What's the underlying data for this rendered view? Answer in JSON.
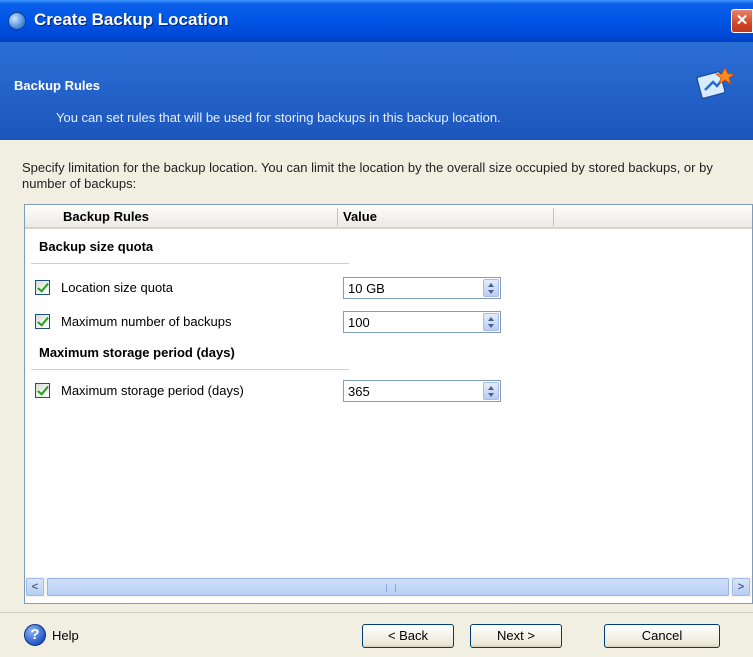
{
  "window": {
    "title": "Create Backup Location"
  },
  "banner": {
    "title": "Backup Rules",
    "subtitle": "You can set rules that will be used for storing backups in this backup location."
  },
  "intro": "Specify limitation for the backup location. You can limit the location by the overall size occupied by stored backups, or by number of backups:",
  "grid": {
    "col_rules": "Backup Rules",
    "col_value": "Value",
    "groups": [
      {
        "label": "Backup size quota",
        "rows": [
          {
            "label": "Location size quota",
            "value": "10 GB",
            "checked": true
          },
          {
            "label": "Maximum number of backups",
            "value": "100",
            "checked": true
          }
        ]
      },
      {
        "label": "Maximum storage period (days)",
        "rows": [
          {
            "label": "Maximum storage period (days)",
            "value": "365",
            "checked": true
          }
        ]
      }
    ]
  },
  "footer": {
    "help": "Help",
    "back": "< Back",
    "next": "Next >",
    "cancel": "Cancel"
  },
  "icons": {
    "title": "app-icon",
    "close": "close-icon",
    "banner": "backup-rules-icon",
    "help": "help-icon",
    "checkbox": "checkbox-checked-icon",
    "scroll_left": "arrow-left-icon",
    "scroll_right": "arrow-right-icon"
  },
  "colors": {
    "titlebar": "#0055e5",
    "banner": "#2b6fd6",
    "check": "#21a121"
  }
}
